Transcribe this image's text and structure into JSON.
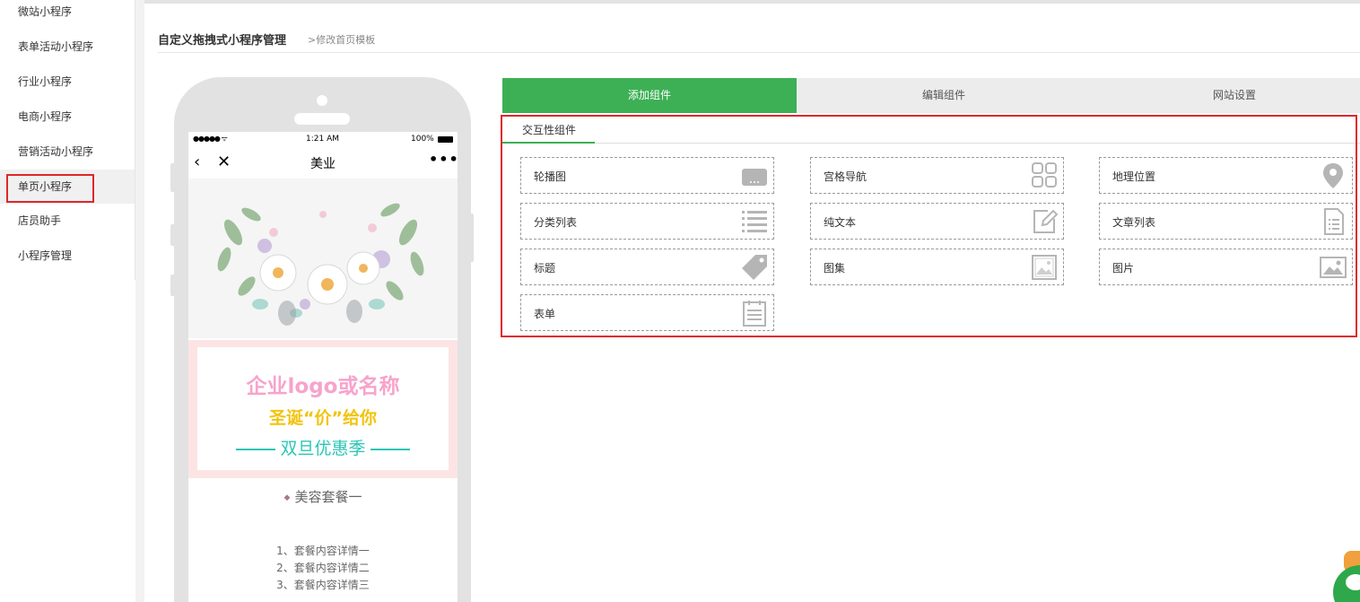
{
  "sidebar": {
    "items": [
      {
        "label": "微站小程序"
      },
      {
        "label": "表单活动小程序"
      },
      {
        "label": "行业小程序"
      },
      {
        "label": "电商小程序"
      },
      {
        "label": "营销活动小程序"
      },
      {
        "label": "单页小程序"
      },
      {
        "label": "店员助手"
      },
      {
        "label": "小程序管理"
      }
    ],
    "active_index": 5
  },
  "header": {
    "title": "自定义拖拽式小程序管理",
    "subtitle": ">修改首页模板"
  },
  "phone": {
    "status": {
      "signal": "●●●●● ᯤ",
      "time": "1:21 AM",
      "battery": "100%"
    },
    "nav": {
      "back": "‹",
      "close": "✕",
      "title": "美业",
      "more": "•••"
    },
    "banner": {
      "line1": "企业logo或名称",
      "line2": "圣诞“价”给你",
      "line3": "双旦优惠季"
    },
    "package": {
      "title": "美容套餐一",
      "lines": [
        "1、套餐内容详情一",
        "2、套餐内容详情二",
        "3、套餐内容详情三"
      ]
    }
  },
  "tabs": [
    {
      "label": "添加组件",
      "active": true
    },
    {
      "label": "编辑组件",
      "active": false
    },
    {
      "label": "网站设置",
      "active": false
    }
  ],
  "component_panel": {
    "subtab": "交互性组件",
    "components": [
      {
        "label": "轮播图",
        "icon": "carousel-icon"
      },
      {
        "label": "宫格导航",
        "icon": "grid-nav-icon"
      },
      {
        "label": "地理位置",
        "icon": "location-pin-icon"
      },
      {
        "label": "分类列表",
        "icon": "list-icon"
      },
      {
        "label": "纯文本",
        "icon": "edit-text-icon"
      },
      {
        "label": "文章列表",
        "icon": "article-list-icon"
      },
      {
        "label": "标题",
        "icon": "tag-icon"
      },
      {
        "label": "图集",
        "icon": "gallery-icon"
      },
      {
        "label": "图片",
        "icon": "image-icon"
      },
      {
        "label": "表单",
        "icon": "form-icon"
      }
    ]
  },
  "colors": {
    "accent_green": "#3db055",
    "highlight_red": "#e0262a",
    "icon_gray": "#b5b5b5"
  }
}
